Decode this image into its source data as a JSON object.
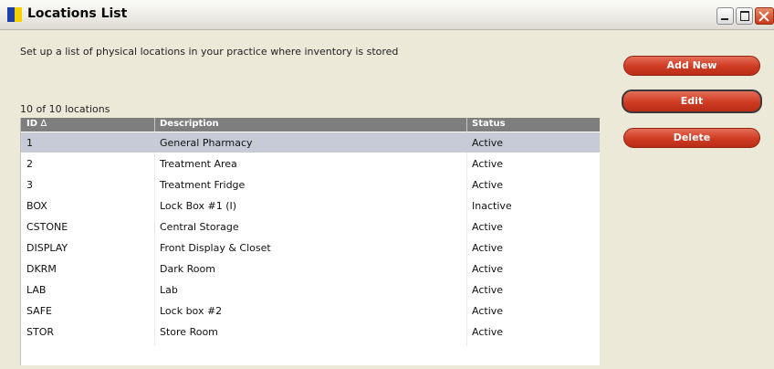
{
  "window": {
    "title": "Locations List"
  },
  "description": "Set up a list of physical locations in your practice where inventory is stored",
  "count_label": "10 of 10 locations",
  "columns": {
    "id": "ID",
    "sort_indicator": "∆",
    "description": "Description",
    "status": "Status"
  },
  "rows": [
    {
      "id": "1",
      "description": "General Pharmacy",
      "status": "Active",
      "selected": true
    },
    {
      "id": "2",
      "description": "Treatment Area",
      "status": "Active"
    },
    {
      "id": "3",
      "description": "Treatment Fridge",
      "status": "Active"
    },
    {
      "id": "BOX",
      "description": "Lock Box #1 (I)",
      "status": "Inactive"
    },
    {
      "id": "CSTONE",
      "description": "Central Storage",
      "status": "Active"
    },
    {
      "id": "DISPLAY",
      "description": "Front Display & Closet",
      "status": "Active"
    },
    {
      "id": "DKRM",
      "description": "Dark Room",
      "status": "Active"
    },
    {
      "id": "LAB",
      "description": "Lab",
      "status": "Active"
    },
    {
      "id": "SAFE",
      "description": "Lock box #2",
      "status": "Active"
    },
    {
      "id": "STOR",
      "description": "Store Room",
      "status": "Active"
    }
  ],
  "buttons": {
    "add_new": "Add New",
    "edit": "Edit",
    "delete": "Delete"
  },
  "colors": {
    "button_red": "#cf3b23",
    "selected_row": "#c6cbd7",
    "header_gray": "#7e7e7e"
  }
}
